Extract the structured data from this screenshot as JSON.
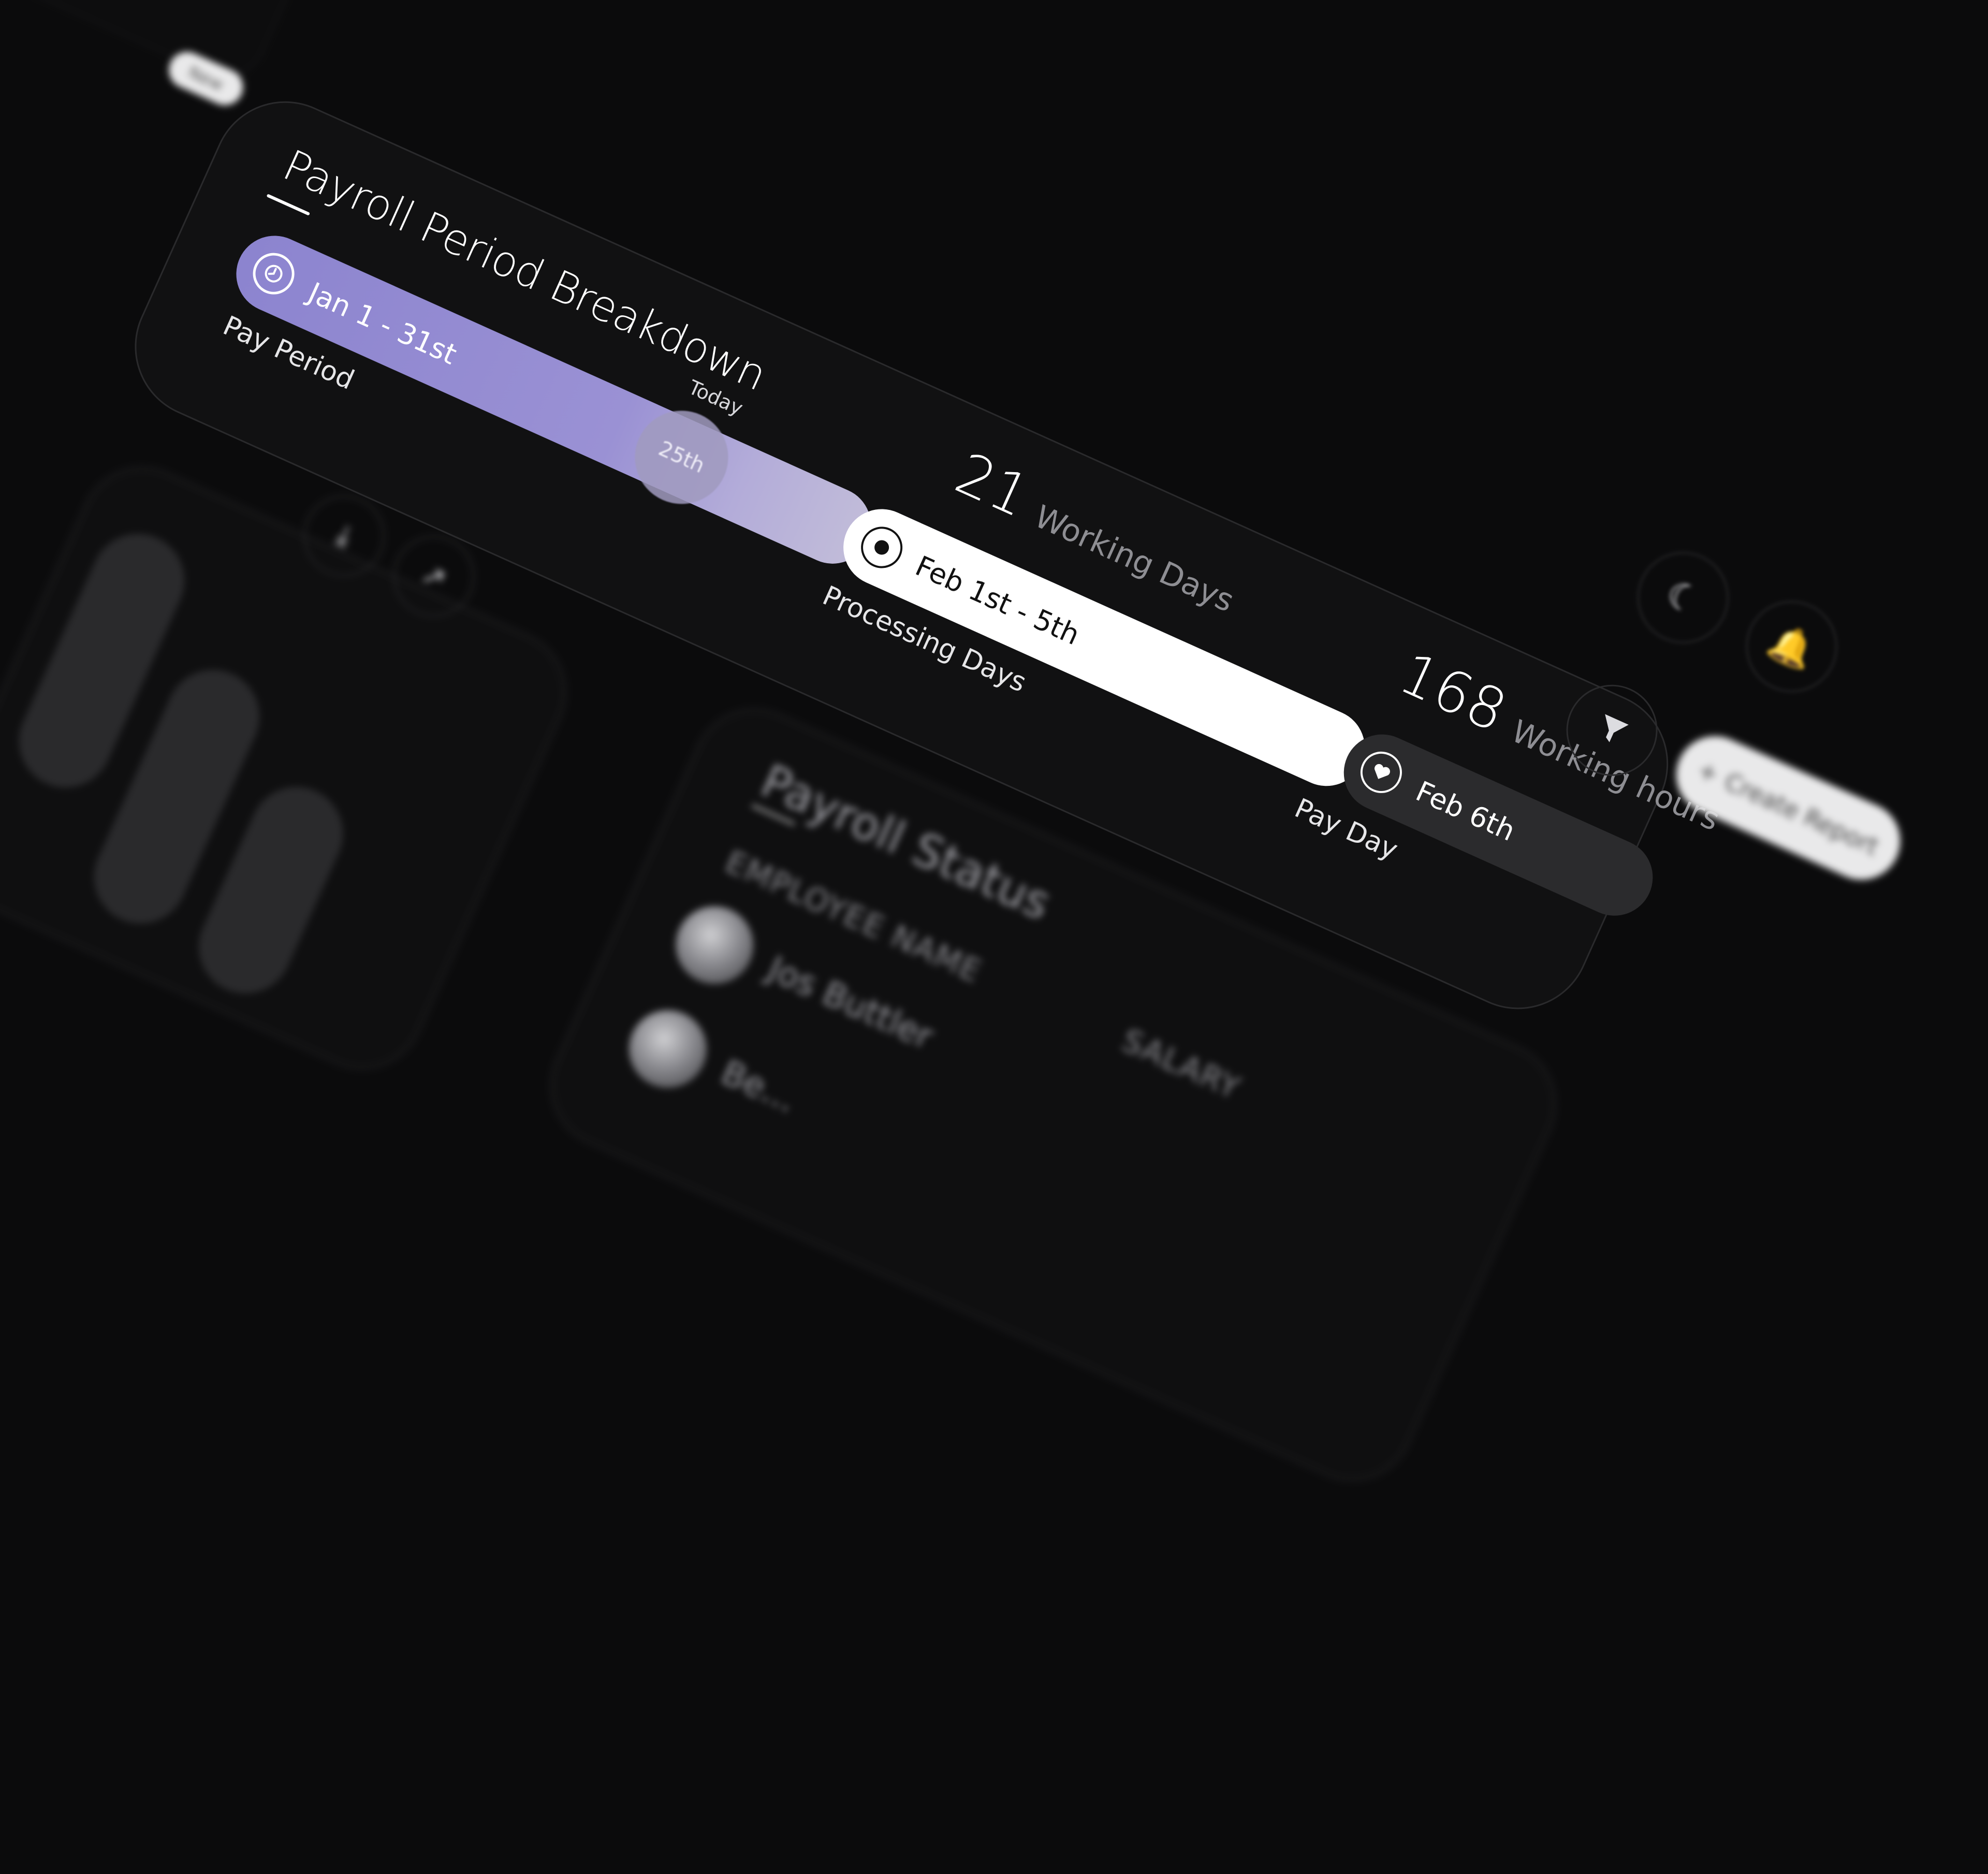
{
  "background": {
    "new_label": "New"
  },
  "card": {
    "title": "Payroll Period Breakdown",
    "segments": {
      "pay_period": {
        "range": "Jan 1 - 31st",
        "caption": "Pay Period",
        "icon": "clock-icon"
      },
      "today": {
        "label": "Today",
        "day": "25th"
      },
      "processing": {
        "range": "Feb 1st - 5th",
        "caption": "Processing Days",
        "icon": "radio-dot-icon"
      },
      "pay_day": {
        "range": "Feb 6th",
        "caption": "Pay Day",
        "icon": "heart-icon"
      }
    },
    "stats": {
      "working_days": {
        "value": "21",
        "unit": "Working Days"
      },
      "working_hours": {
        "value": "168",
        "unit": "Working hours"
      }
    },
    "colors": {
      "pay_period": "#8c84cf",
      "processing": "#ffffff",
      "pay_day": "#2b2b2d"
    }
  },
  "controls": {
    "theme_icon": "moon-icon",
    "notification_icon": "bell-icon",
    "filter_icon": "filter-icon",
    "create_report_label": "Create Report",
    "download_icon": "download-icon",
    "share_icon": "arrow-up-right-icon"
  },
  "payroll_status": {
    "title": "Payroll Status",
    "columns": [
      "EMPLOYEE NAME",
      "SALARY"
    ],
    "rows": [
      {
        "name": "Jos Buttler"
      },
      {
        "name": "Be..."
      }
    ]
  }
}
